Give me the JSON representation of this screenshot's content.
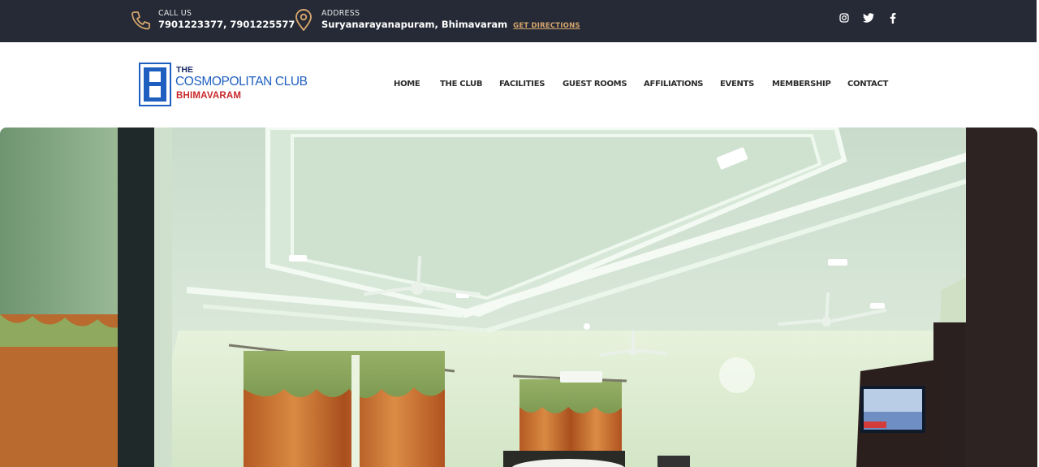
{
  "topbar": {
    "call": {
      "label": "CALL US",
      "value": "7901223377, 7901225577",
      "icon": "phone-icon"
    },
    "address": {
      "label": "ADDRESS",
      "value": "Suryanarayanapuram, Bhimavaram",
      "link": "GET DIRECTIONS",
      "icon": "location-pin-icon"
    },
    "socials": [
      "instagram-icon",
      "twitter-icon",
      "facebook-icon"
    ]
  },
  "logo": {
    "line1": "THE",
    "line2": "COSMOPOLITAN CLUB",
    "line3": "BHIMAVARAM"
  },
  "nav": {
    "items": [
      {
        "label": "HOME"
      },
      {
        "label": "THE CLUB"
      },
      {
        "label": "FACILITIES"
      },
      {
        "label": "GUEST ROOMS"
      },
      {
        "label": "AFFILIATIONS"
      },
      {
        "label": "EVENTS"
      },
      {
        "label": "MEMBERSHIP"
      },
      {
        "label": "CONTACT"
      }
    ]
  },
  "hero": {
    "image": "guest-room-photo"
  },
  "colors": {
    "topbar_bg": "#252a36",
    "accent": "#d6a56c",
    "brand_blue": "#1e5fbf",
    "brand_red": "#c8282a"
  }
}
